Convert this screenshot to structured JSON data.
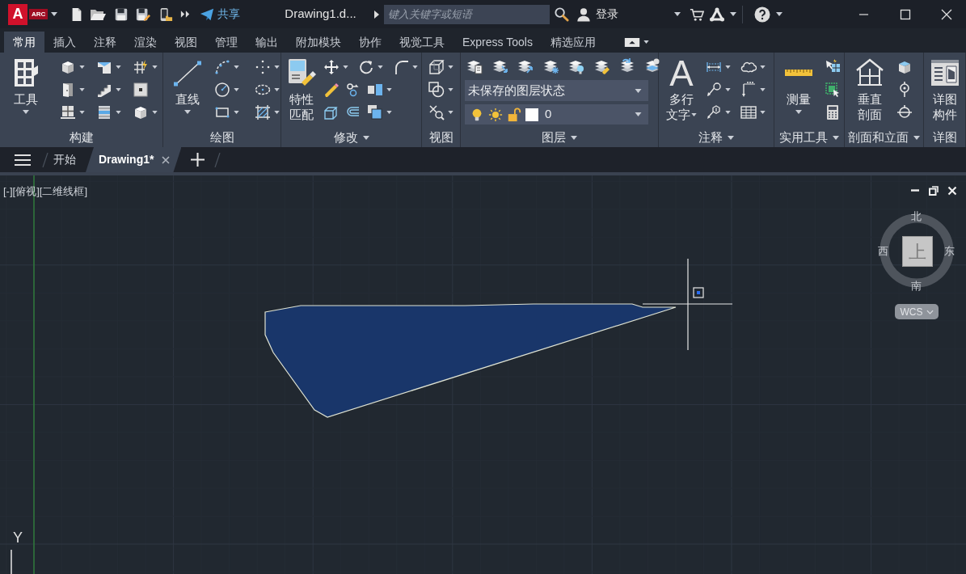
{
  "title_bar": {
    "logo": {
      "letter": "A",
      "badge": "ARC"
    },
    "share_label": "共享",
    "document_title": "Drawing1.d...",
    "search": {
      "placeholder": "键入关键字或短语"
    },
    "sign_in_label": "登录"
  },
  "ribbon_tabs": [
    {
      "label": "常用",
      "selected": true
    },
    {
      "label": "插入",
      "selected": false
    },
    {
      "label": "注释",
      "selected": false
    },
    {
      "label": "渲染",
      "selected": false
    },
    {
      "label": "视图",
      "selected": false
    },
    {
      "label": "管理",
      "selected": false
    },
    {
      "label": "输出",
      "selected": false
    },
    {
      "label": "附加模块",
      "selected": false
    },
    {
      "label": "协作",
      "selected": false
    },
    {
      "label": "视觉工具",
      "selected": false
    },
    {
      "label": "Express Tools",
      "selected": false
    },
    {
      "label": "精选应用",
      "selected": false
    }
  ],
  "ribbon_panels": [
    {
      "kind": "build",
      "title": "构建",
      "menu": false,
      "large_tool": {
        "lines": [
          "工具"
        ],
        "menu": true
      }
    },
    {
      "kind": "draw",
      "title": "绘图",
      "menu": false,
      "large_tool": {
        "lines": [
          "直线"
        ],
        "menu": true
      }
    },
    {
      "kind": "modify",
      "title": "修改",
      "menu": true,
      "large_tool": {
        "lines": [
          "特性",
          "匹配"
        ],
        "menu": false
      }
    },
    {
      "kind": "view",
      "title": "视图",
      "menu": false
    },
    {
      "kind": "layers",
      "title": "图层",
      "menu": true,
      "layer_state": "未保存的图层状态",
      "current_layer": {
        "name": "0",
        "on": true,
        "frozen": false,
        "locked": false
      }
    },
    {
      "kind": "annotate",
      "title": "注释",
      "menu": true,
      "large_tool": {
        "glyph": "A",
        "lines": [
          "多行",
          "文字"
        ],
        "menu": true
      }
    },
    {
      "kind": "utilities",
      "title": "实用工具",
      "menu": true,
      "large_tool": {
        "lines": [
          "测量"
        ],
        "menu": true
      }
    },
    {
      "kind": "section",
      "title": "剖面和立面",
      "menu": true,
      "large_tool": {
        "lines": [
          "垂直",
          "剖面"
        ],
        "menu": false
      }
    },
    {
      "kind": "detail",
      "title": "详图",
      "menu": false,
      "large_tool": {
        "lines": [
          "详图",
          "构件"
        ],
        "menu": false
      }
    }
  ],
  "file_tabs": [
    {
      "label": "开始",
      "selected": false,
      "closable": false
    },
    {
      "label": "Drawing1*",
      "selected": true,
      "closable": true
    }
  ],
  "viewport": {
    "label": "[-][俯视][二维线框]",
    "view_cube": {
      "north": "北",
      "west": "西",
      "face": "上",
      "east": "东",
      "south": "南",
      "coordinate_system": "WCS"
    },
    "ucs_label": "Y"
  }
}
